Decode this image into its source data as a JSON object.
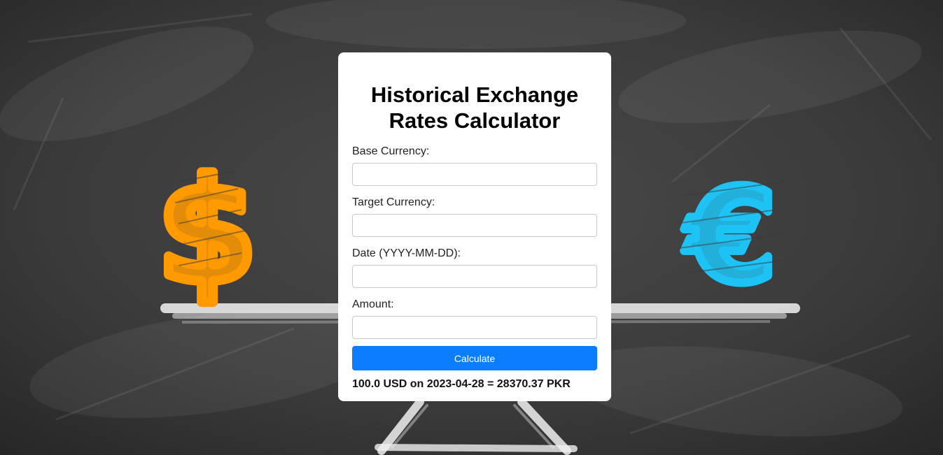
{
  "app": {
    "title": "Historical Exchange Rates Calculator"
  },
  "form": {
    "fields": [
      {
        "label": "Base Currency:",
        "value": "",
        "placeholder": ""
      },
      {
        "label": "Target Currency:",
        "value": "",
        "placeholder": ""
      },
      {
        "label": "Date (YYYY-MM-DD):",
        "value": "",
        "placeholder": ""
      },
      {
        "label": "Amount:",
        "value": "",
        "placeholder": ""
      }
    ],
    "submit_label": "Calculate"
  },
  "result": {
    "text": "100.0 USD on 2023-04-28 = 28370.37 PKR"
  },
  "background": {
    "left_symbol": "$",
    "right_symbol": "€",
    "colors": {
      "chalkboard": "#3a3a3a",
      "dollar": "#ff9a00",
      "euro": "#1ec3f5",
      "chalk": "#f2f2f2",
      "button": "#0a7dff"
    }
  }
}
